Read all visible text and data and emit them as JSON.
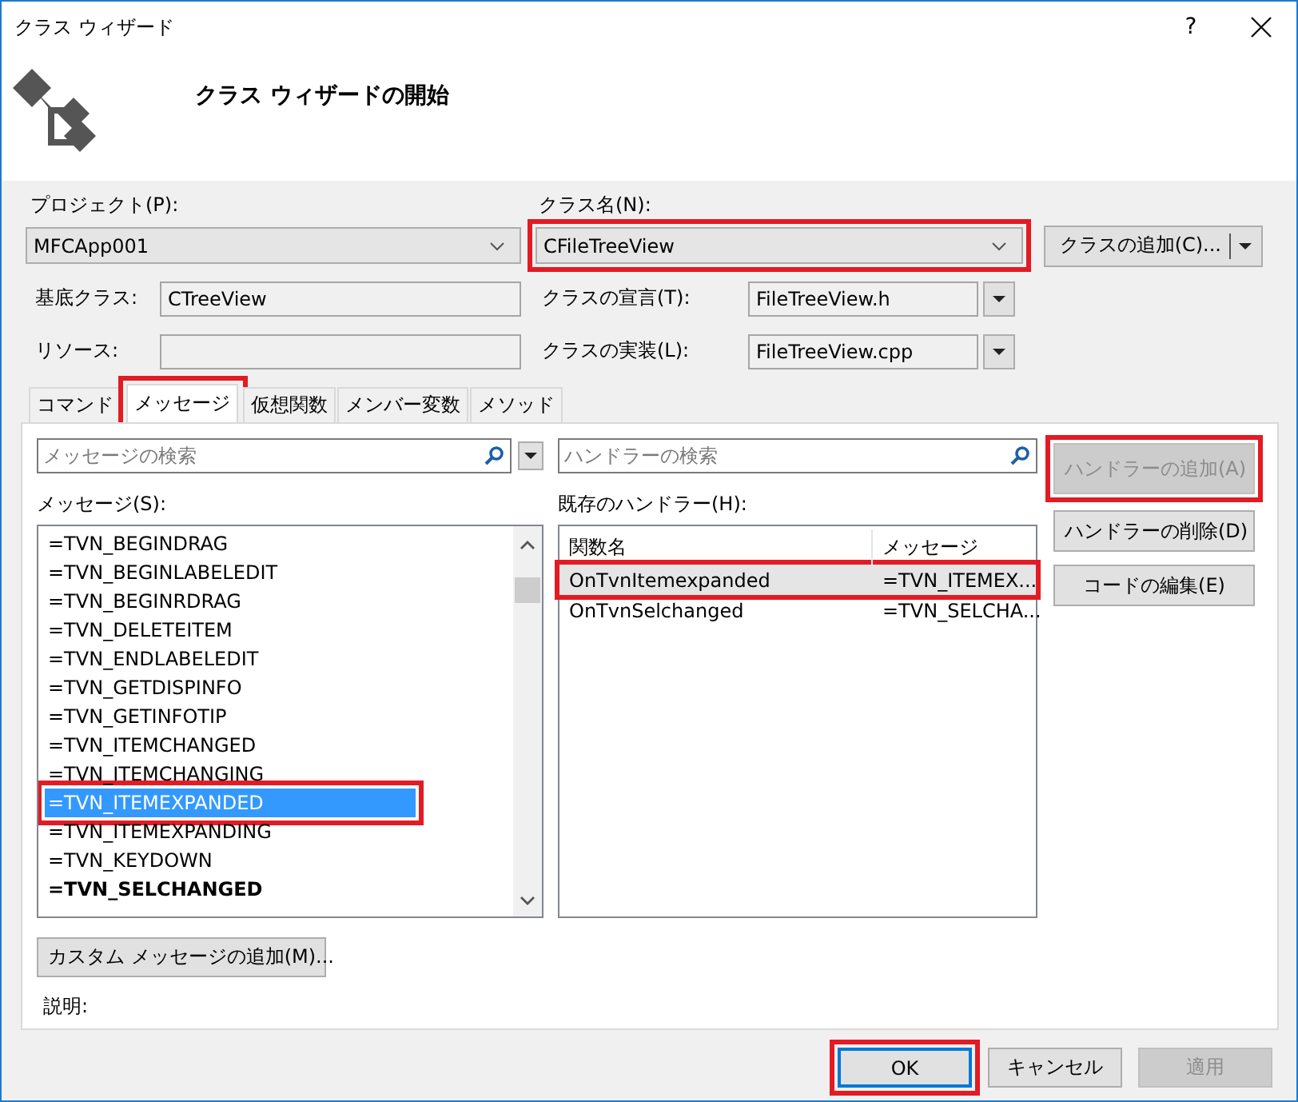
{
  "window": {
    "title": "クラス ウィザード",
    "help": "?"
  },
  "header": {
    "title": "クラス ウィザードの開始"
  },
  "project": {
    "label": "プロジェクト(P):",
    "value": "MFCApp001"
  },
  "class_name": {
    "label": "クラス名(N):",
    "value": "CFileTreeView",
    "highlighted": true
  },
  "add_class_button": {
    "label": "クラスの追加(C)..."
  },
  "base_class": {
    "label": "基底クラス:",
    "value": "CTreeView"
  },
  "resource": {
    "label": "リソース:"
  },
  "declaration": {
    "label": "クラスの宣言(T):",
    "value": "FileTreeView.h"
  },
  "implementation": {
    "label": "クラスの実装(L):",
    "value": "FileTreeView.cpp"
  },
  "tabs": [
    {
      "label": "コマンド",
      "selected": false,
      "highlighted": false
    },
    {
      "label": "メッセージ",
      "selected": true,
      "highlighted": true
    },
    {
      "label": "仮想関数",
      "selected": false,
      "highlighted": false
    },
    {
      "label": "メンバー変数",
      "selected": false,
      "highlighted": false
    },
    {
      "label": "メソッド",
      "selected": false,
      "highlighted": false
    }
  ],
  "message_search": {
    "placeholder": "メッセージの検索"
  },
  "handler_search": {
    "placeholder": "ハンドラーの検索"
  },
  "messages": {
    "label": "メッセージ(S):",
    "items": [
      {
        "label": "=TVN_BEGINDRAG",
        "selected": false,
        "bold": false,
        "highlighted": false
      },
      {
        "label": "=TVN_BEGINLABELEDIT",
        "selected": false,
        "bold": false,
        "highlighted": false
      },
      {
        "label": "=TVN_BEGINRDRAG",
        "selected": false,
        "bold": false,
        "highlighted": false
      },
      {
        "label": "=TVN_DELETEITEM",
        "selected": false,
        "bold": false,
        "highlighted": false
      },
      {
        "label": "=TVN_ENDLABELEDIT",
        "selected": false,
        "bold": false,
        "highlighted": false
      },
      {
        "label": "=TVN_GETDISPINFO",
        "selected": false,
        "bold": false,
        "highlighted": false
      },
      {
        "label": "=TVN_GETINFOTIP",
        "selected": false,
        "bold": false,
        "highlighted": false
      },
      {
        "label": "=TVN_ITEMCHANGED",
        "selected": false,
        "bold": false,
        "highlighted": false
      },
      {
        "label": "=TVN_ITEMCHANGING",
        "selected": false,
        "bold": false,
        "highlighted": false
      },
      {
        "label": "=TVN_ITEMEXPANDED",
        "selected": true,
        "bold": false,
        "highlighted": true
      },
      {
        "label": "=TVN_ITEMEXPANDING",
        "selected": false,
        "bold": false,
        "highlighted": false
      },
      {
        "label": "=TVN_KEYDOWN",
        "selected": false,
        "bold": false,
        "highlighted": false
      },
      {
        "label": "=TVN_SELCHANGED",
        "selected": false,
        "bold": true,
        "highlighted": false
      }
    ]
  },
  "handlers": {
    "label": "既存のハンドラー(H):",
    "columns": [
      "関数名",
      "メッセージ"
    ],
    "rows": [
      {
        "cells": [
          "OnTvnItemexpanded",
          "=TVN_ITEMEX..."
        ],
        "selected": true,
        "highlighted": true
      },
      {
        "cells": [
          "OnTvnSelchanged",
          "=TVN_SELCHA..."
        ],
        "selected": false,
        "highlighted": false
      }
    ]
  },
  "side_buttons": [
    {
      "label": "ハンドラーの追加(A)",
      "disabled": true,
      "highlighted": true
    },
    {
      "label": "ハンドラーの削除(D)",
      "disabled": false,
      "highlighted": false
    },
    {
      "label": "コードの編集(E)",
      "disabled": false,
      "highlighted": false
    }
  ],
  "custom_message_button": {
    "label": "カスタム メッセージの追加(M)..."
  },
  "description": {
    "label": "説明:"
  },
  "buttons": [
    {
      "label": "OK",
      "default": true,
      "disabled": false,
      "highlighted": true
    },
    {
      "label": "キャンセル",
      "default": false,
      "disabled": false,
      "highlighted": false
    },
    {
      "label": "適用",
      "default": false,
      "disabled": true,
      "highlighted": false
    }
  ]
}
